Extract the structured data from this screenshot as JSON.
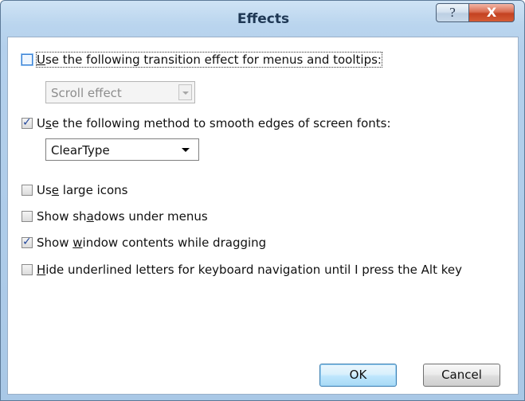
{
  "window": {
    "title": "Effects",
    "help_glyph": "?",
    "close_glyph": "X"
  },
  "options": {
    "transition": {
      "label_pre": "",
      "label_ul": "U",
      "label_post": "se the following transition effect for menus and tooltips:",
      "checked": false,
      "combo_value": "Scroll effect",
      "combo_enabled": false
    },
    "smooth_edges": {
      "label_pre": "U",
      "label_ul": "s",
      "label_post": "e the following method to smooth edges of screen fonts:",
      "checked": true,
      "combo_value": "ClearType",
      "combo_enabled": true
    },
    "large_icons": {
      "label_pre": "Us",
      "label_ul": "e",
      "label_post": " large icons",
      "checked": false
    },
    "shadows": {
      "label_pre": "Show sh",
      "label_ul": "a",
      "label_post": "dows under menus",
      "checked": false
    },
    "window_contents": {
      "label_pre": "Show ",
      "label_ul": "w",
      "label_post": "indow contents while dragging",
      "checked": true
    },
    "hide_underlines": {
      "label_pre": "",
      "label_ul": "H",
      "label_post": "ide underlined letters for keyboard navigation until I press the Alt key",
      "checked": false
    }
  },
  "buttons": {
    "ok": "OK",
    "cancel": "Cancel"
  },
  "icons": {
    "help": "help-icon",
    "close": "close-icon",
    "checkmark": "checkmark-icon",
    "dropdown": "chevron-down-icon"
  },
  "colors": {
    "title_text": "#1e3754",
    "close_button": "#c44221",
    "default_button": "#bee6fd",
    "checkmark": "#24489b"
  }
}
